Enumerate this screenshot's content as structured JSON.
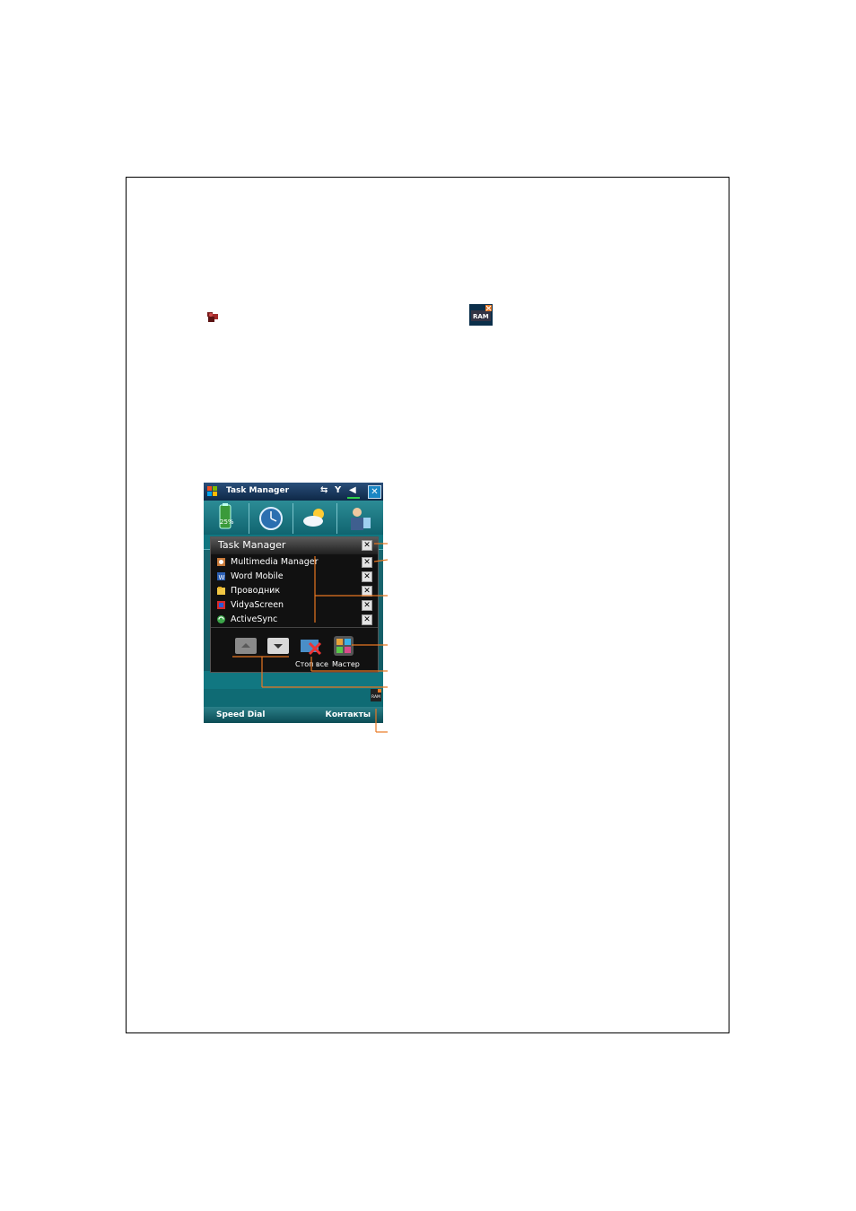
{
  "window": {
    "title": "Task Manager",
    "status_icons": [
      "network-icon",
      "signal-icon",
      "volume-icon"
    ],
    "close_label": "✕"
  },
  "tiles": [
    {
      "icon": "battery-icon",
      "label": "25%"
    },
    {
      "icon": "clock-icon"
    },
    {
      "icon": "weather-icon"
    },
    {
      "icon": "contact-icon"
    }
  ],
  "task_manager": {
    "title": "Task Manager",
    "close_label": "✕",
    "tasks": [
      {
        "name": "Multimedia Manager",
        "icon": "multimedia-icon",
        "close": "✕"
      },
      {
        "name": "Word Mobile",
        "icon": "word-icon",
        "close": "✕"
      },
      {
        "name": "Проводник",
        "icon": "explorer-icon",
        "close": "✕"
      },
      {
        "name": "VidyaScreen",
        "icon": "vidyascreen-icon",
        "close": "✕"
      },
      {
        "name": "ActiveSync",
        "icon": "activesync-icon",
        "close": "✕"
      }
    ],
    "controls": {
      "stop_all_label": "Стоп все",
      "wizard_label": "Мастер"
    }
  },
  "softkeys": {
    "left": "Speed Dial",
    "right": "Контакты"
  },
  "colors": {
    "accent_orange": "#e87722",
    "screen_teal": "#117781",
    "panel_black": "#111111"
  }
}
